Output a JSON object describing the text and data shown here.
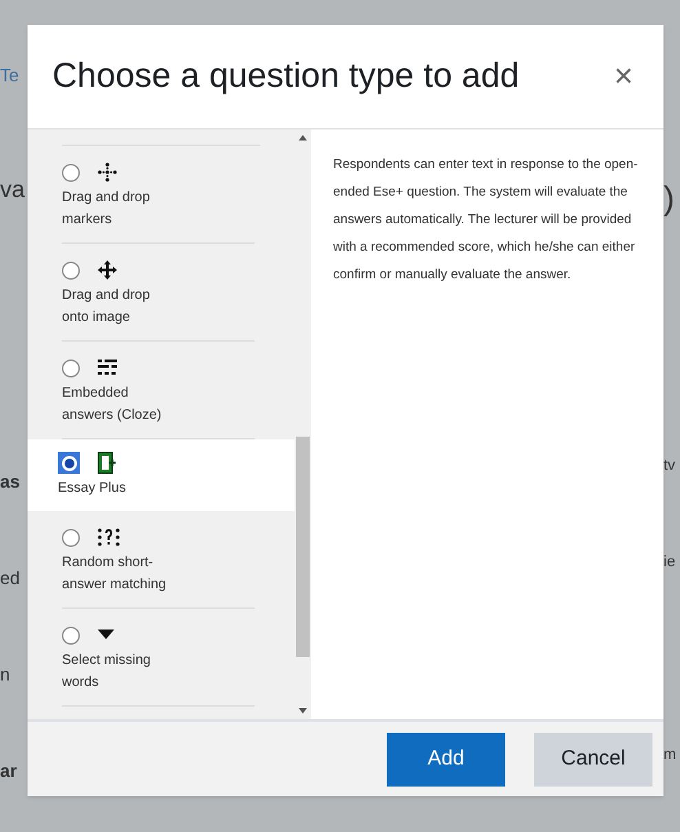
{
  "background": {
    "left_fragments": [
      "Te",
      "va",
      "as",
      "ed",
      "n",
      "ar"
    ],
    "right_fragments": [
      ")",
      "tv",
      "ie",
      "m"
    ]
  },
  "dialog": {
    "title": "Choose a question type to add",
    "close": "×",
    "options": [
      {
        "label": "Drag and drop markers",
        "selected": false
      },
      {
        "label": "Drag and drop onto image",
        "selected": false
      },
      {
        "label": "Embedded answers (Cloze)",
        "selected": false
      },
      {
        "label": "Essay Plus",
        "selected": true
      },
      {
        "label": "Random short-answer matching",
        "selected": false
      },
      {
        "label": "Select missing words",
        "selected": false
      }
    ],
    "description": "Respondents can enter text in response to the open-ended Ese+ question. The system will evaluate the answers automatically. The lecturer will be provided with a recommended score, which he/she can either confirm or manually evaluate the answer.",
    "buttons": [
      {
        "label": "Add",
        "kind": "primary"
      },
      {
        "label": "Cancel",
        "kind": "secondary"
      }
    ]
  }
}
